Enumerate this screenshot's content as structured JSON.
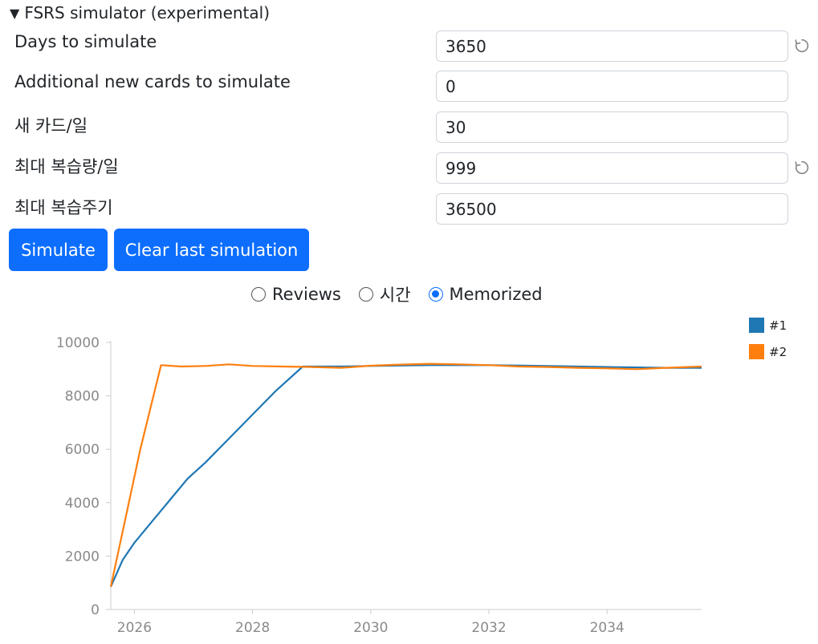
{
  "summary": {
    "triangle": "▼",
    "title": "FSRS simulator (experimental)"
  },
  "fields": [
    {
      "label": "Days to simulate",
      "value": "3650",
      "reset": true
    },
    {
      "label": "Additional new cards to simulate",
      "value": "0",
      "reset": false
    },
    {
      "label": "새 카드/일",
      "value": "30",
      "reset": false
    },
    {
      "label": "최대 복습량/일",
      "value": "999",
      "reset": true
    },
    {
      "label": "최대 복습주기",
      "value": "36500",
      "reset": false
    }
  ],
  "buttons": {
    "simulate": "Simulate",
    "clear": "Clear last simulation"
  },
  "radios": [
    {
      "label": "Reviews",
      "checked": false
    },
    {
      "label": "시간",
      "checked": false
    },
    {
      "label": "Memorized",
      "checked": true
    }
  ],
  "chart_data": {
    "type": "line",
    "ylim": [
      0,
      10000
    ],
    "yticks": [
      0,
      2000,
      4000,
      6000,
      8000,
      10000
    ],
    "xlim": [
      2025.6,
      2035.6
    ],
    "xticks": [
      2026,
      2028,
      2030,
      2032,
      2034
    ],
    "series": [
      {
        "name": "#1",
        "color": "#1f77b4",
        "x": [
          2025.6,
          2025.8,
          2026.0,
          2026.3,
          2026.6,
          2026.9,
          2027.2,
          2027.6,
          2028.0,
          2028.4,
          2028.85,
          2029.5,
          2030.0,
          2031.0,
          2032.0,
          2033.0,
          2034.0,
          2035.0,
          2035.6
        ],
        "values": [
          850,
          1850,
          2500,
          3300,
          4100,
          4900,
          5500,
          6400,
          7300,
          8200,
          9100,
          9100,
          9120,
          9150,
          9150,
          9120,
          9080,
          9050,
          9050
        ]
      },
      {
        "name": "#2",
        "color": "#ff7f0e",
        "x": [
          2025.6,
          2026.1,
          2026.45,
          2026.8,
          2027.2,
          2027.6,
          2028.0,
          2028.5,
          2029.0,
          2029.5,
          2030.0,
          2030.5,
          2031.0,
          2031.5,
          2032.0,
          2032.5,
          2033.0,
          2033.5,
          2034.0,
          2034.5,
          2035.0,
          2035.6
        ],
        "values": [
          850,
          6000,
          9150,
          9100,
          9120,
          9180,
          9120,
          9100,
          9080,
          9050,
          9130,
          9170,
          9200,
          9180,
          9150,
          9100,
          9080,
          9050,
          9030,
          9000,
          9050,
          9100
        ]
      }
    ]
  }
}
